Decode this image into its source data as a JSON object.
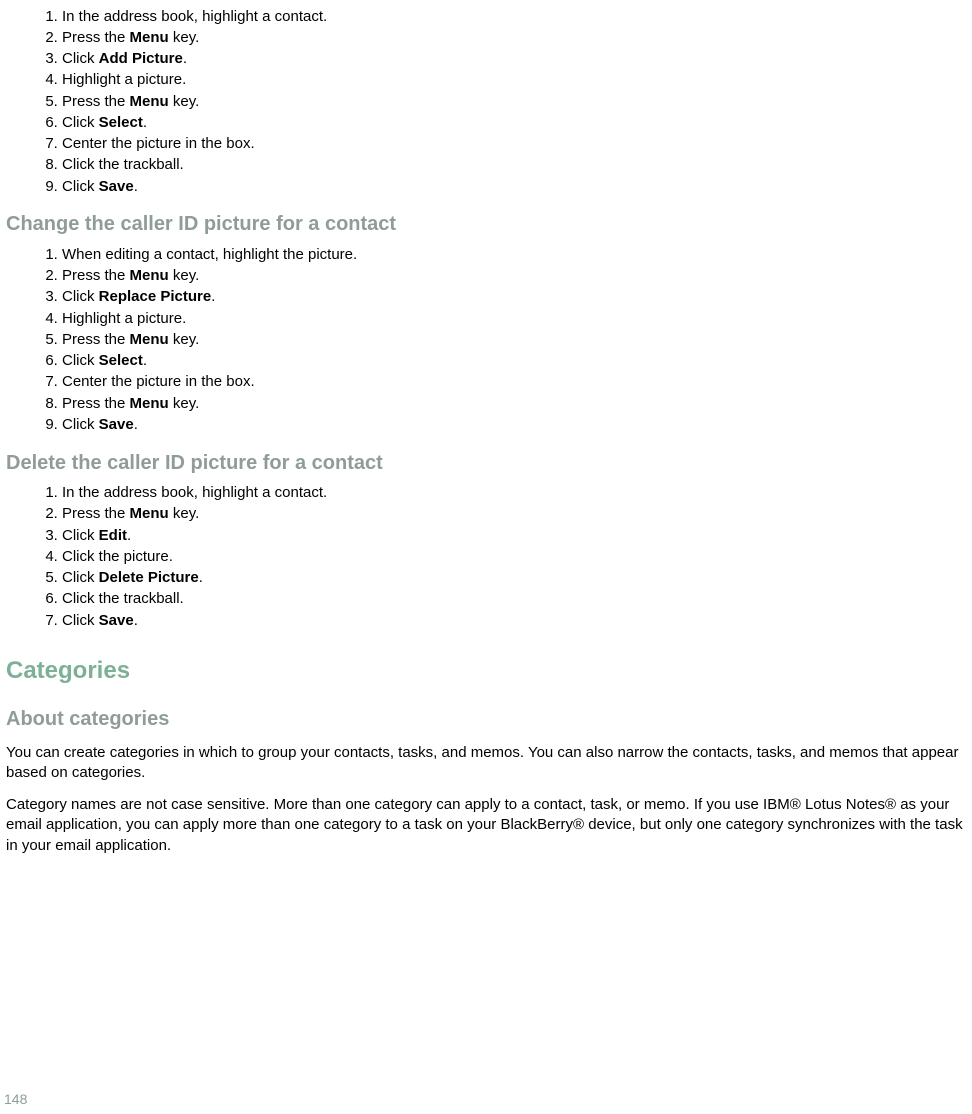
{
  "lists": {
    "addPicture": [
      {
        "pre": "In the address book, highlight a contact.",
        "bold": "",
        "post": ""
      },
      {
        "pre": "Press the ",
        "bold": "Menu",
        "post": " key."
      },
      {
        "pre": "Click ",
        "bold": "Add Picture",
        "post": "."
      },
      {
        "pre": "Highlight a picture.",
        "bold": "",
        "post": ""
      },
      {
        "pre": "Press the ",
        "bold": "Menu",
        "post": " key."
      },
      {
        "pre": "Click ",
        "bold": "Select",
        "post": "."
      },
      {
        "pre": "Center the picture in the box.",
        "bold": "",
        "post": ""
      },
      {
        "pre": "Click the trackball.",
        "bold": "",
        "post": ""
      },
      {
        "pre": "Click ",
        "bold": "Save",
        "post": "."
      }
    ],
    "changePicture": [
      {
        "pre": "When editing a contact, highlight the picture.",
        "bold": "",
        "post": ""
      },
      {
        "pre": "Press the ",
        "bold": "Menu",
        "post": " key."
      },
      {
        "pre": "Click ",
        "bold": "Replace Picture",
        "post": "."
      },
      {
        "pre": "Highlight a picture.",
        "bold": "",
        "post": ""
      },
      {
        "pre": "Press the ",
        "bold": "Menu",
        "post": " key."
      },
      {
        "pre": "Click ",
        "bold": "Select",
        "post": "."
      },
      {
        "pre": "Center the picture in the box.",
        "bold": "",
        "post": ""
      },
      {
        "pre": "Press the ",
        "bold": "Menu",
        "post": " key."
      },
      {
        "pre": "Click ",
        "bold": "Save",
        "post": "."
      }
    ],
    "deletePicture": [
      {
        "pre": "In the address book, highlight a contact.",
        "bold": "",
        "post": ""
      },
      {
        "pre": "Press the ",
        "bold": "Menu",
        "post": " key."
      },
      {
        "pre": "Click ",
        "bold": "Edit",
        "post": "."
      },
      {
        "pre": "Click the picture.",
        "bold": "",
        "post": ""
      },
      {
        "pre": "Click ",
        "bold": "Delete Picture",
        "post": "."
      },
      {
        "pre": "Click the trackball.",
        "bold": "",
        "post": ""
      },
      {
        "pre": "Click ",
        "bold": "Save",
        "post": "."
      }
    ]
  },
  "headings": {
    "change": "Change the caller ID picture for a contact",
    "delete": "Delete the caller ID picture for a contact",
    "categories": "Categories",
    "about": "About categories"
  },
  "paragraphs": {
    "p1": "You can create categories in which to group your contacts, tasks, and memos. You can also narrow the contacts, tasks, and memos that appear based on categories.",
    "p2": "Category names are not case sensitive. More than one category can apply to a contact, task, or memo. If you use IBM® Lotus Notes® as your email application, you can apply more than one category to a task on your BlackBerry® device, but only one category synchronizes with the task in your email application."
  },
  "pageNumber": "148"
}
